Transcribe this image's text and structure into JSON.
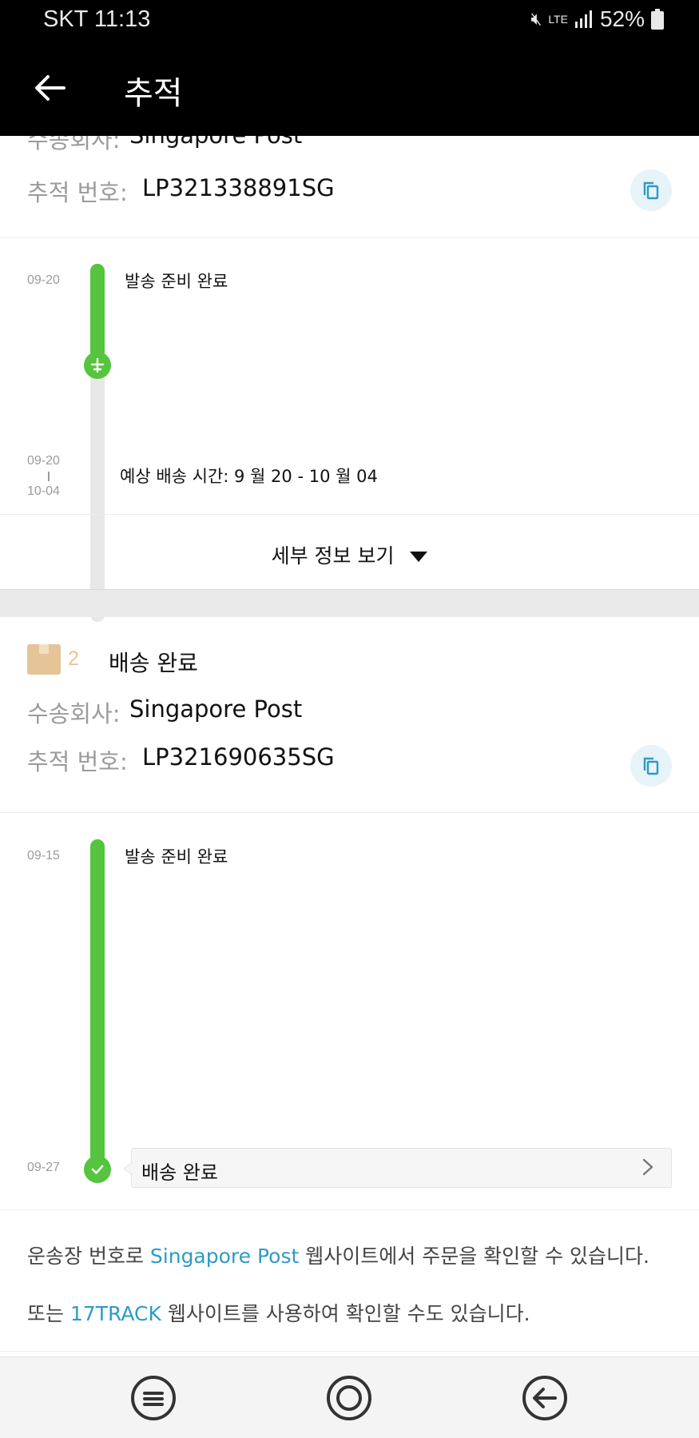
{
  "status_bar": {
    "carrier_time": "SKT 11:13",
    "network": "LTE",
    "battery": "52%"
  },
  "app_bar": {
    "title": "추적"
  },
  "shipment1": {
    "carrier_label": "수송회사:",
    "carrier": "Singapore Post",
    "tracking_label": "추적 번호:",
    "tracking_number": "LP321338891SG",
    "events": [
      {
        "date": "09-20",
        "text": "발송 준비 완료"
      }
    ],
    "eta_date_start": "09-20",
    "eta_date_end": "10-04",
    "eta_text": "예상 배송 시간: 9 월 20 - 10 월 04",
    "details_label": "세부 정보 보기"
  },
  "shipment2": {
    "index": "2",
    "status_title": "배송 완료",
    "carrier_label": "수송회사:",
    "carrier": "Singapore Post",
    "tracking_label": "추적 번호:",
    "tracking_number": "LP321690635SG",
    "events": [
      {
        "date": "09-15",
        "text": "발송 준비 완료"
      },
      {
        "date": "09-27",
        "text": "배송 완료"
      }
    ]
  },
  "notes": {
    "line1_prefix": "운송장 번호로 ",
    "line1_link": "Singapore Post",
    "line1_suffix": " 웹사이트에서 주문을 확인할 수 있습니다.",
    "line2_prefix": "또는 ",
    "line2_link": "17TRACK",
    "line2_suffix": " 웹사이트를 사용하여 확인할 수도 있습니다."
  },
  "colors": {
    "accent_green": "#55c43e",
    "link_blue": "#2d9bc4",
    "box_tan": "#e5c497"
  },
  "icons": [
    "back-arrow-icon",
    "copy-icon",
    "plane-icon",
    "check-icon",
    "box-icon",
    "caret-down-icon",
    "chevron-right-icon",
    "recents-icon",
    "home-icon",
    "back-icon"
  ]
}
